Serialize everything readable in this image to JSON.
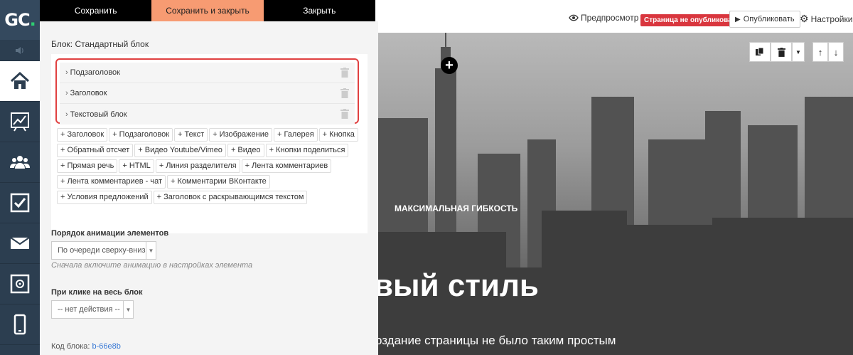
{
  "logo": {
    "text": "GC",
    "dot": "."
  },
  "toolbar": {
    "save": "Сохранить",
    "save_close": "Сохранить и закрыть",
    "close": "Закрыть"
  },
  "block": {
    "title": "Блок: Стандартный блок",
    "elements": [
      "Подзаголовок",
      "Заголовок",
      "Текстовый блок"
    ],
    "add_buttons": [
      "+ Заголовок",
      "+ Подзаголовок",
      "+ Текст",
      "+ Изображение",
      "+ Галерея",
      "+ Кнопка",
      "+ Обратный отсчет",
      "+ Видео Youtube/Vimeo",
      "+ Видео",
      "+ Кнопки поделиться",
      "+ Прямая речь",
      "+ HTML",
      "+ Линия разделителя",
      "+ Лента комментариев",
      "+ Лента комментариев - чат",
      "+ Комментарии ВКонтакте",
      "+ Условия предложений",
      "+ Заголовок с раскрывающимся текстом"
    ]
  },
  "animation": {
    "label": "Порядок анимации элементов",
    "value": "По очереди сверху-вниз",
    "hint": "Сначала включите анимацию в настройках элемента"
  },
  "click": {
    "label": "При клике на весь блок",
    "value": "-- нет действия --"
  },
  "code": {
    "label": "Код блока:",
    "value": "b-66e8b"
  },
  "preview": {
    "preview_label": "Предпросмотр",
    "status": "Страница не опубликована",
    "publish": "Опубликовать",
    "settings": "Настройки",
    "subtitle": "МАКСИМАЛЬНАЯ ГИБКОСТЬ",
    "heading": "вый стиль",
    "text": "оздание страницы не было таким простым"
  },
  "colors": {
    "accent": "#f79b72",
    "nav": "#2c3e50",
    "badge": "#d9363e",
    "logo_dot": "#2ecc71"
  }
}
